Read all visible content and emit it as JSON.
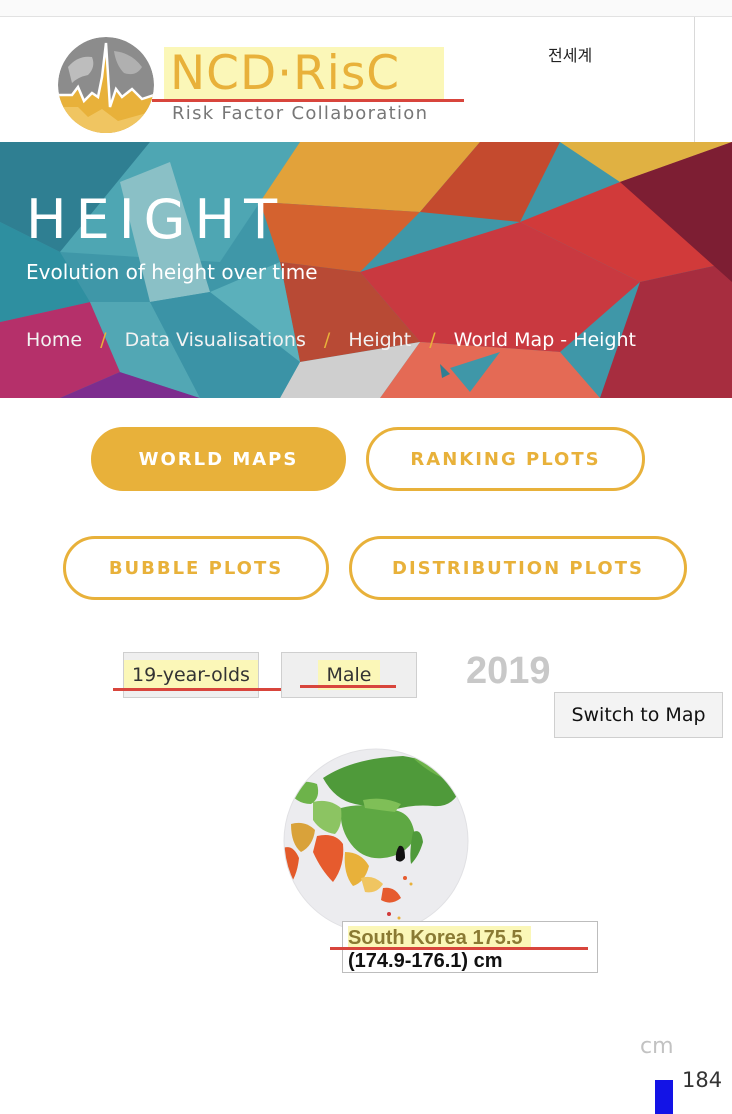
{
  "header": {
    "logo_title": "NCD·RisC",
    "logo_subtitle": "Risk Factor Collaboration",
    "language_link": "전세계"
  },
  "banner": {
    "title": "HEIGHT",
    "subtitle": "Evolution of height over time",
    "breadcrumb": {
      "items": [
        "Home",
        "Data Visualisations",
        "Height",
        "World Map - Height"
      ],
      "separator": "/"
    }
  },
  "nav": {
    "world_maps": "WORLD MAPS",
    "ranking_plots": "RANKING PLOTS",
    "bubble_plots": "BUBBLE PLOTS",
    "distribution_plots": "DISTRIBUTION PLOTS"
  },
  "controls": {
    "age_group": "19-year-olds",
    "sex": "Male",
    "year": "2019",
    "switch_button": "Switch to Map"
  },
  "tooltip": {
    "line1": "South Korea 175.5",
    "line2": "(174.9-176.1) cm"
  },
  "legend": {
    "unit": "cm",
    "top_value": "184"
  },
  "colors": {
    "accent": "#e8b13a",
    "highlight": "#fbf7b8",
    "annotation_red": "#d8453c",
    "legend_blue": "#1313e6"
  },
  "icons": {
    "logo": "globe-heartbeat-logo-icon"
  }
}
